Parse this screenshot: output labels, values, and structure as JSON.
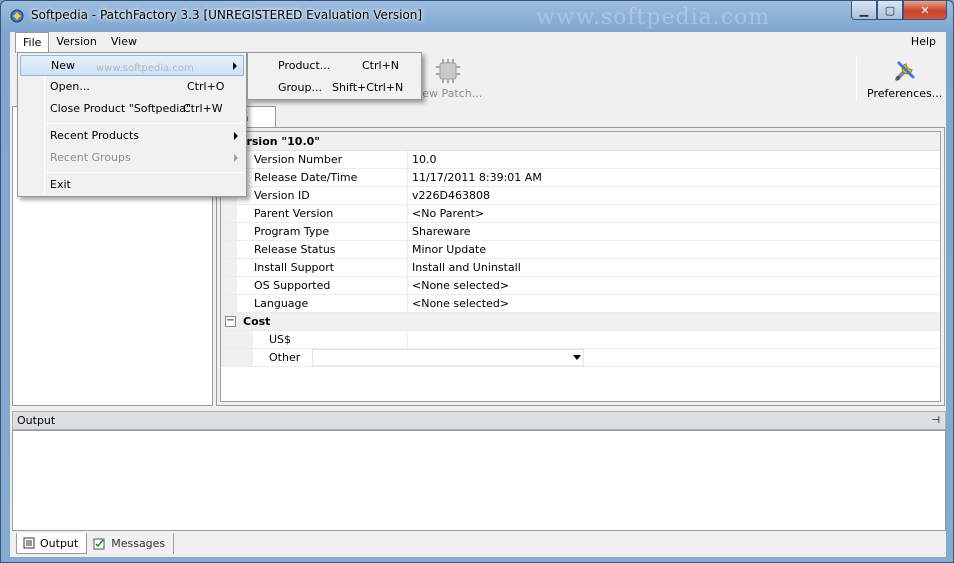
{
  "window": {
    "title": "Softpedia  -  PatchFactory 3.3  [UNREGISTERED Evaluation Version]",
    "watermark": "www.softpedia.com",
    "minimize": "▁",
    "maximize": "▢",
    "close": "✕"
  },
  "menubar": {
    "file": "File",
    "version": "Version",
    "view": "View",
    "help": "Help"
  },
  "toolbar": {
    "new_patch": "New Patch...",
    "preferences": "Preferences..."
  },
  "editor": {
    "tab_label": "edia",
    "group_header": "ersion \"10.0\"",
    "properties": [
      {
        "name": "Version Number",
        "value": "10.0"
      },
      {
        "name": "Release Date/Time",
        "value": "11/17/2011 8:39:01 AM"
      },
      {
        "name": "Version ID",
        "value": "v226D463808"
      },
      {
        "name": "Parent Version",
        "value": "<No Parent>"
      },
      {
        "name": "Program Type",
        "value": "Shareware"
      },
      {
        "name": "Release Status",
        "value": "Minor Update"
      },
      {
        "name": "Install Support",
        "value": "Install and Uninstall"
      },
      {
        "name": "OS Supported",
        "value": "<None selected>"
      },
      {
        "name": "Language",
        "value": "<None selected>"
      }
    ],
    "cost": {
      "label": "Cost",
      "toggle": "−",
      "usd": "US$",
      "other": "Other"
    }
  },
  "output": {
    "title": "Output",
    "pin": "⊣"
  },
  "bottom_tabs": {
    "output": "Output",
    "messages": "Messages"
  },
  "file_menu": {
    "new": "New",
    "open": "Open...",
    "open_shortcut": "Ctrl+O",
    "close_product": "Close Product \"Softpedia\"",
    "close_shortcut": "Ctrl+W",
    "recent_products": "Recent Products",
    "recent_groups": "Recent Groups",
    "exit": "Exit",
    "watermark": "www.softpedia.com"
  },
  "new_submenu": {
    "product": "Product...",
    "product_shortcut": "Ctrl+N",
    "group": "Group...",
    "group_shortcut": "Shift+Ctrl+N"
  }
}
